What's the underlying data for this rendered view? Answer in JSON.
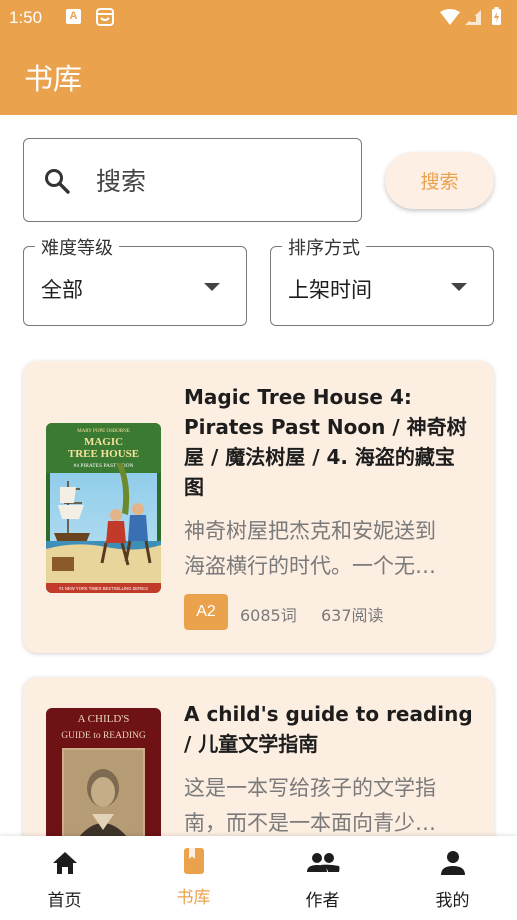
{
  "status_bar": {
    "time": "1:50",
    "notification_letter": "A"
  },
  "app_bar": {
    "title": "书库"
  },
  "search": {
    "placeholder": "搜索",
    "button_label": "搜索"
  },
  "filters": {
    "difficulty": {
      "label": "难度等级",
      "value": "全部"
    },
    "sort": {
      "label": "排序方式",
      "value": "上架时间"
    }
  },
  "books": [
    {
      "title": "Magic Tree House 4: Pirates Past Noon / 神奇树屋 / 魔法树屋 / 4. 海盗的藏宝图",
      "desc_lines": [
        "神奇树屋把杰克和安妮送到",
        "海盗横行的时代。一个无…"
      ],
      "level": "A2",
      "words": "6085词",
      "reads": "637阅读",
      "cover": {
        "top_text": "MARY POPE OSBORNE",
        "title_1": "MAGIC",
        "title_2": "TREE HOUSE",
        "subtitle": "#4 PIRATES PAST NOON",
        "footer": "#1 NEW YORK TIMES BESTSELLING SERIES"
      }
    },
    {
      "title": "A child's guide to reading / 儿童文学指南",
      "desc_lines": [
        "这是一本写给孩子的文学指",
        "南，而不是一本面向青少…"
      ],
      "cover": {
        "title_1": "A CHILD'S",
        "title_2": "GUIDE to READING"
      }
    }
  ],
  "bottom_nav": [
    {
      "label": "首页",
      "icon": "home-icon"
    },
    {
      "label": "书库",
      "icon": "book-icon",
      "active": true
    },
    {
      "label": "作者",
      "icon": "people-icon"
    },
    {
      "label": "我的",
      "icon": "person-icon"
    }
  ],
  "colors": {
    "accent": "#eba24d",
    "card_bg": "#fdeee2",
    "search_button_bg": "#fdefe3"
  }
}
